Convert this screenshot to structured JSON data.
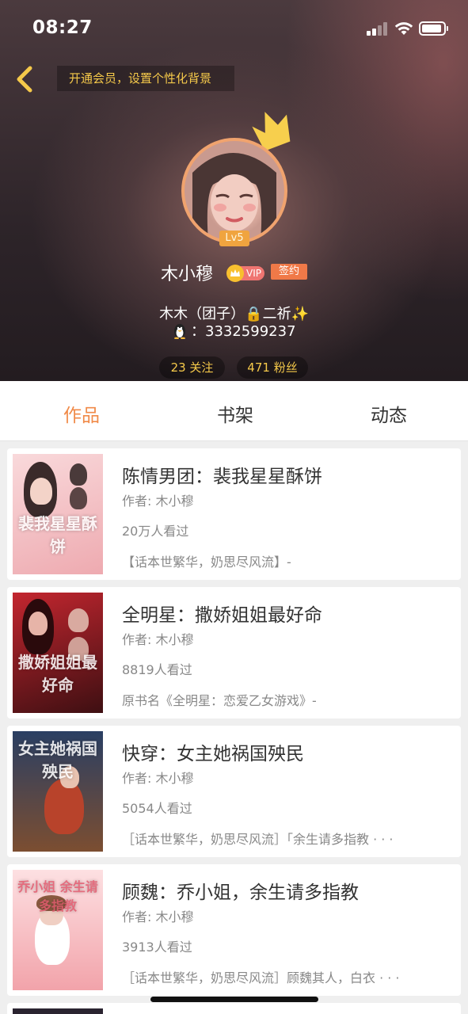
{
  "status_bar": {
    "time": "08:27"
  },
  "header": {
    "vip_banner": "开通会员，设置个性化背景",
    "level": "Lv5",
    "username": "木小穆",
    "vip_label": "VIP",
    "sign_label": "签约",
    "bio": "木木（团子）🔒二祈✨",
    "qq": "：3332599237",
    "follow_count": "23 关注",
    "fans_count": "471 粉丝"
  },
  "tabs": [
    {
      "label": "作品",
      "active": true
    },
    {
      "label": "书架",
      "active": false
    },
    {
      "label": "动态",
      "active": false
    }
  ],
  "books": [
    {
      "title": "陈情男团：裴我星星酥饼",
      "author": "作者: 木小穆",
      "views": "20万人看过",
      "desc": "【话本世繁华，奶思尽风流】-",
      "cover_text": "裴我星星酥饼",
      "cover_colors": [
        "#f6c7c9",
        "#e9a6ac"
      ]
    },
    {
      "title": "全明星：撒娇姐姐最好命",
      "author": "作者: 木小穆",
      "views": "8819人看过",
      "desc": "原书名《全明星：恋爱乙女游戏》-",
      "cover_text": "撒娇姐姐最好命",
      "cover_colors": [
        "#b3242d",
        "#4a1216"
      ]
    },
    {
      "title": "快穿：女主她祸国殃民",
      "author": "作者: 木小穆",
      "views": "5054人看过",
      "desc": "［话本世繁华，奶思尽风流］「余生请多指教 · · ·",
      "cover_text": "女主她祸国殃民",
      "cover_colors": [
        "#2e4a73",
        "#8a5a3c"
      ]
    },
    {
      "title": "顾魏：乔小姐，余生请多指教",
      "author": "作者: 木小穆",
      "views": "3913人看过",
      "desc": "［话本世繁华，奶思尽风流］顾魏其人，白衣 · · ·",
      "cover_text": "乔小姐 余生请多指教",
      "cover_colors": [
        "#fbd3d6",
        "#f19ea5"
      ]
    }
  ]
}
